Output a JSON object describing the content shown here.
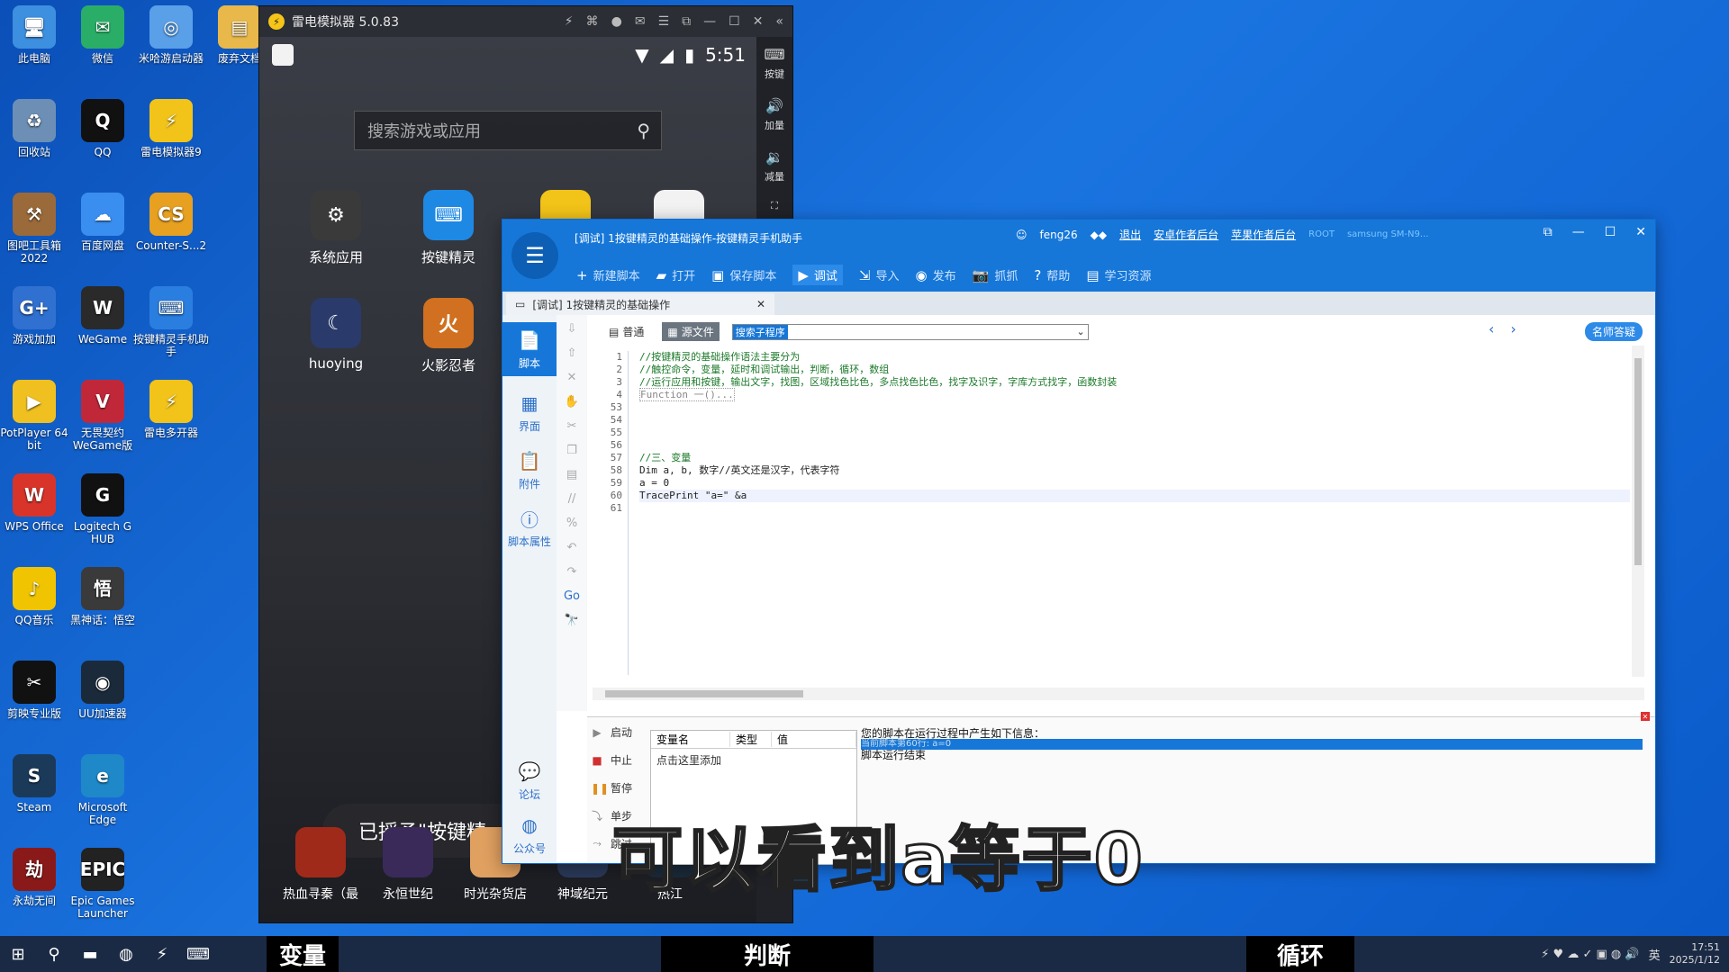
{
  "desktop": {
    "icons": [
      {
        "label": "此电脑",
        "glyph": "🖥",
        "color": "#3d8fe0"
      },
      {
        "label": "微信",
        "glyph": "✉",
        "color": "#2aae67"
      },
      {
        "label": "米哈游启动器",
        "glyph": "◎",
        "color": "#5aa0e8"
      },
      {
        "label": "废弃文档",
        "glyph": "▤",
        "color": "#e8b84a"
      },
      {
        "label": "回收站",
        "glyph": "♻",
        "color": "#6d8fb5"
      },
      {
        "label": "QQ",
        "glyph": "Q",
        "color": "#111111"
      },
      {
        "label": "雷电模拟器9",
        "glyph": "⚡",
        "color": "#f2c318"
      },
      {
        "label": "图吧工具箱2022",
        "glyph": "⚒",
        "color": "#9a6a3a"
      },
      {
        "label": "百度网盘",
        "glyph": "☁",
        "color": "#3a8ef0"
      },
      {
        "label": "Counter-S...2",
        "glyph": "CS",
        "color": "#e8a020"
      },
      {
        "label": "游戏加加",
        "glyph": "G+",
        "color": "#3070d0"
      },
      {
        "label": "WeGame",
        "glyph": "W",
        "color": "#2a2a2a"
      },
      {
        "label": "按键精灵手机助手",
        "glyph": "⌨",
        "color": "#2a7ee0"
      },
      {
        "label": "PotPlayer 64 bit",
        "glyph": "▶",
        "color": "#f0c020"
      },
      {
        "label": "无畏契约WeGame版",
        "glyph": "V",
        "color": "#c0283a"
      },
      {
        "label": "雷电多开器",
        "glyph": "⚡",
        "color": "#f2c318"
      },
      {
        "label": "WPS Office",
        "glyph": "W",
        "color": "#d8342a"
      },
      {
        "label": "Logitech G HUB",
        "glyph": "G",
        "color": "#111111"
      },
      {
        "label": "QQ音乐",
        "glyph": "♪",
        "color": "#f0c400"
      },
      {
        "label": "黑神话：悟空",
        "glyph": "悟",
        "color": "#3a3a3a"
      },
      {
        "label": "剪映专业版",
        "glyph": "✂",
        "color": "#111111"
      },
      {
        "label": "UU加速器",
        "glyph": "◉",
        "color": "#1a2a3a"
      },
      {
        "label": "Steam",
        "glyph": "S",
        "color": "#1b3a5a"
      },
      {
        "label": "Microsoft Edge",
        "glyph": "e",
        "color": "#1e88c8"
      },
      {
        "label": "永劫无间",
        "glyph": "劫",
        "color": "#8a1a1a"
      },
      {
        "label": "Epic Games Launcher",
        "glyph": "EPIC",
        "color": "#222222"
      }
    ]
  },
  "emulator": {
    "title": "雷电模拟器 5.0.83",
    "time": "5:51",
    "search_placeholder": "搜索游戏或应用",
    "side_buttons": [
      {
        "label": "按键",
        "glyph": "⌨"
      },
      {
        "label": "加量",
        "glyph": "🔊"
      },
      {
        "label": "减量",
        "glyph": "🔉"
      }
    ],
    "apps": [
      {
        "label": "系统应用",
        "glyph": "⚙",
        "color": "#3a3a3a"
      },
      {
        "label": "按键精灵",
        "glyph": "⌨",
        "color": "#1e88e5"
      },
      {
        "label": "huoying",
        "glyph": "☾",
        "color": "#2a3a6a"
      },
      {
        "label": "火影忍者",
        "glyph": "火",
        "color": "#d07020"
      }
    ],
    "dock": [
      "热血寻秦（最",
      "永恒世纪",
      "时光杂货店",
      "神域纪元",
      "热江"
    ],
    "toast": "已授予\"按键精"
  },
  "ide": {
    "title": "[调试] 1按键精灵的基础操作-按键精灵手机助手",
    "user": "feng26",
    "links": [
      "退出",
      "安卓作者后台",
      "苹果作者后台"
    ],
    "root_label": "ROOT",
    "device": "samsung SM-N9...",
    "toolbar": [
      {
        "label": "新建脚本",
        "glyph": "+"
      },
      {
        "label": "打开",
        "glyph": "▰"
      },
      {
        "label": "保存脚本",
        "glyph": "▣"
      },
      {
        "label": "调试",
        "glyph": "▶",
        "active": true
      },
      {
        "label": "导入",
        "glyph": "⇲"
      },
      {
        "label": "发布",
        "glyph": "◉"
      },
      {
        "label": "抓抓",
        "glyph": "📷"
      },
      {
        "label": "帮助",
        "glyph": "?"
      },
      {
        "label": "学习资源",
        "glyph": "▤"
      }
    ],
    "tab_label": "[调试] 1按键精灵的基础操作",
    "left_nav": [
      {
        "label": "脚本",
        "glyph": "📄",
        "selected": true
      },
      {
        "label": "界面",
        "glyph": "▦"
      },
      {
        "label": "附件",
        "glyph": "📋"
      },
      {
        "label": "脚本属性",
        "glyph": "ⓘ"
      }
    ],
    "left_nav_bottom": [
      {
        "label": "论坛",
        "glyph": "💬"
      },
      {
        "label": "公众号",
        "glyph": "◍"
      }
    ],
    "modes": [
      "普通",
      "源文件"
    ],
    "search_sub": "搜索子程序",
    "ask_button": "名师答疑",
    "line_numbers": [
      "1",
      "2",
      "3",
      "4",
      "53",
      "54",
      "55",
      "56",
      "57",
      "58",
      "59",
      "60",
      "61"
    ],
    "code_lines": [
      {
        "text": "//按键精灵的基础操作语法主要分为",
        "kind": "comment"
      },
      {
        "text": "//触控命令，变量，延时和调试输出，判断，循环，数组",
        "kind": "comment"
      },
      {
        "text": "//运行应用和按键，输出文字，找图，区域找色比色，多点找色比色，找字及识字，字库方式找字，函数封装",
        "kind": "comment"
      },
      {
        "text": "Function 一()...",
        "kind": "fold"
      },
      {
        "text": "",
        "kind": "plain"
      },
      {
        "text": "",
        "kind": "plain"
      },
      {
        "text": "",
        "kind": "plain"
      },
      {
        "text": "",
        "kind": "plain"
      },
      {
        "text": "//三、变量",
        "kind": "comment"
      },
      {
        "text": "Dim a, b, 数字//英文还是汉字，代表字符",
        "kind": "plain"
      },
      {
        "text": "a = 0",
        "kind": "plain"
      },
      {
        "text": "TracePrint \"a=\" &a",
        "kind": "current"
      },
      {
        "text": "",
        "kind": "plain"
      }
    ],
    "debug_buttons": [
      {
        "label": "启动",
        "glyph": "▶",
        "color": "#888888"
      },
      {
        "label": "中止",
        "glyph": "■",
        "color": "#d03030"
      },
      {
        "label": "暂停",
        "glyph": "❚❚",
        "color": "#e09020"
      },
      {
        "label": "单步",
        "glyph": "⤵",
        "color": "#888888"
      },
      {
        "label": "跳过",
        "glyph": "⤳",
        "color": "#888888"
      }
    ],
    "var_headers": [
      "变量名",
      "类型",
      "值"
    ],
    "var_add": "点击这里添加",
    "output": {
      "header": "您的脚本在运行过程中产生如下信息：",
      "highlight": "当前脚本第60行: a=0",
      "end": "脚本运行结束"
    }
  },
  "caption": "可以看到a等于0",
  "taskbar": {
    "blocks": [
      "变量",
      "判断",
      "循环"
    ],
    "clock_time": "17:51",
    "clock_date": "2025/1/12",
    "ime": "英"
  }
}
